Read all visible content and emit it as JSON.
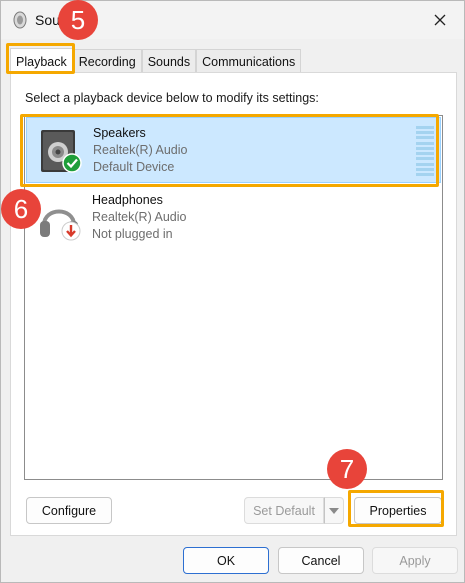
{
  "window": {
    "title": "Sound",
    "title_visible": "Sou"
  },
  "tabs": [
    {
      "label": "Playback",
      "active": true
    },
    {
      "label": "Recording",
      "active": false
    },
    {
      "label": "Sounds",
      "active": false
    },
    {
      "label": "Communications",
      "active": false
    }
  ],
  "instruction": "Select a playback device below to modify its settings:",
  "devices": [
    {
      "name": "Speakers",
      "driver": "Realtek(R) Audio",
      "status": "Default Device",
      "icon": "speaker-icon",
      "status_icon": "green-check-icon",
      "selected": true
    },
    {
      "name": "Headphones",
      "driver": "Realtek(R) Audio",
      "status": "Not plugged in",
      "icon": "headphones-icon",
      "status_icon": "red-down-arrow-icon",
      "selected": false
    }
  ],
  "buttons": {
    "configure": "Configure",
    "set_default": "Set Default",
    "properties": "Properties",
    "ok": "OK",
    "cancel": "Cancel",
    "apply": "Apply"
  },
  "annotations": {
    "step5": "5",
    "step6": "6",
    "step7": "7"
  },
  "colors": {
    "highlight": "#f5a800",
    "badge": "#e8443a",
    "selection": "#cce8ff",
    "status_ok": "#1e9e3a",
    "status_unplugged": "#d83b2b"
  }
}
